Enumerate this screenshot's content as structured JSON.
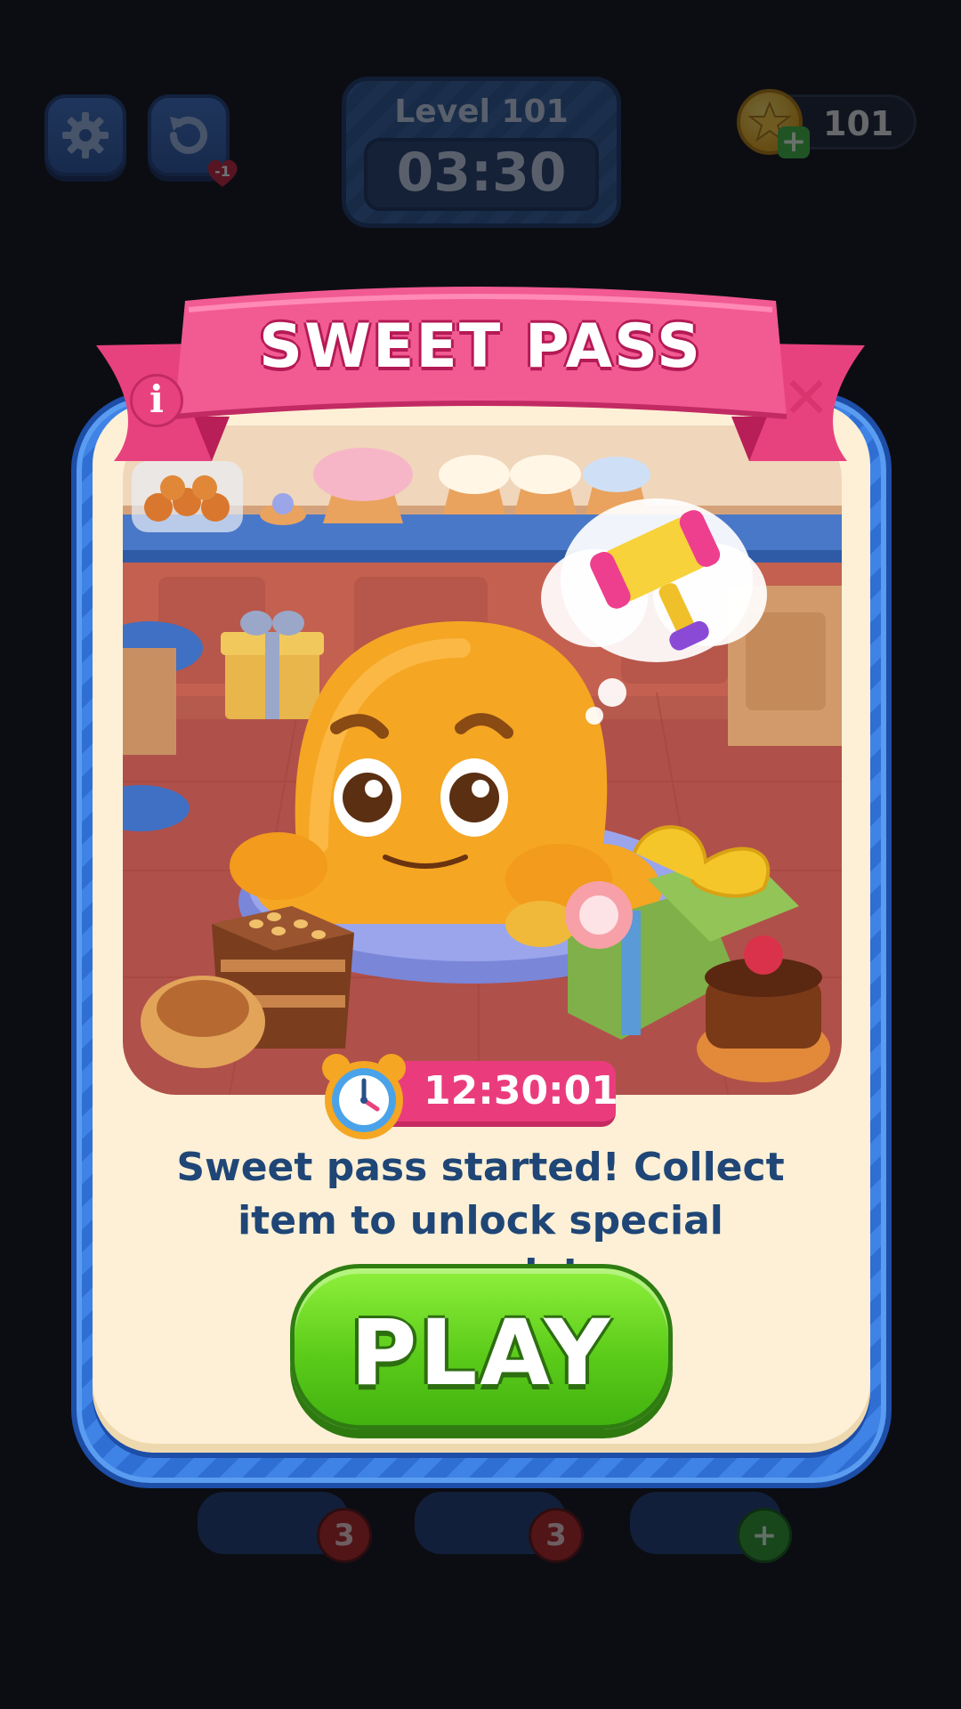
{
  "hud": {
    "level_label": "Level 101",
    "timer": "03:30",
    "coins": "101",
    "coin_plus": "+",
    "undo_badge": "-1",
    "boosters": [
      {
        "name": "booster-1",
        "count": "3"
      },
      {
        "name": "booster-2",
        "count": "3"
      },
      {
        "name": "booster-3",
        "count": "+"
      }
    ],
    "icons": {
      "settings": "gear-icon",
      "undo": "undo-icon",
      "coin": "star-coin-icon"
    }
  },
  "modal": {
    "title": "SWEET PASS",
    "info_label": "i",
    "close_label": "✕",
    "countdown": "12:30:01",
    "message": "Sweet pass started! Collect item to unlock special rewards!",
    "play_label": "PLAY",
    "colors": {
      "ribbon": "#ea3c7d",
      "frame": "#3f83e6",
      "panel": "#fdf0d6",
      "play": "#5ccc1a",
      "text": "#1f4676"
    }
  }
}
